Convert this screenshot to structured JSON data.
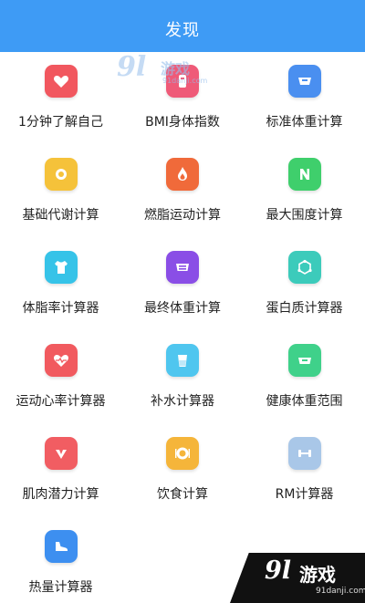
{
  "header": {
    "title": "发现"
  },
  "tools": [
    {
      "label": "1分钟了解自己",
      "icon": "heart-icon",
      "color": "#f1575f"
    },
    {
      "label": "BMI身体指数",
      "icon": "body-icon",
      "color": "#ef5a78"
    },
    {
      "label": "标准体重计算",
      "icon": "scale-icon",
      "color": "#4a8ff0"
    },
    {
      "label": "基础代谢计算",
      "icon": "metabolism-icon",
      "color": "#f5c23a"
    },
    {
      "label": "燃脂运动计算",
      "icon": "flame-icon",
      "color": "#f06a3a"
    },
    {
      "label": "最大围度计算",
      "icon": "n-icon",
      "color": "#3fcf6c"
    },
    {
      "label": "体脂率计算器",
      "icon": "shirt-icon",
      "color": "#36c3e8"
    },
    {
      "label": "最终体重计算",
      "icon": "target-weight-icon",
      "color": "#8a4ee6"
    },
    {
      "label": "蛋白质计算器",
      "icon": "molecule-icon",
      "color": "#3ccbbb"
    },
    {
      "label": "运动心率计算器",
      "icon": "heartbeat-icon",
      "color": "#f15a5f"
    },
    {
      "label": "补水计算器",
      "icon": "water-cup-icon",
      "color": "#4fc6ef"
    },
    {
      "label": "健康体重范围",
      "icon": "health-scale-icon",
      "color": "#3fd18a"
    },
    {
      "label": "肌肉潜力计算",
      "icon": "muscle-icon",
      "color": "#f15d62"
    },
    {
      "label": "饮食计算",
      "icon": "plate-icon",
      "color": "#f5b53a"
    },
    {
      "label": "RM计算器",
      "icon": "dumbbell-icon",
      "color": "#a9c7e8"
    },
    {
      "label": "热量计算器",
      "icon": "shoe-icon",
      "color": "#3d8ff0"
    }
  ],
  "watermark_top": {
    "num": "9l",
    "text": "游戏",
    "url": "91danji.com"
  },
  "watermark_bottom": {
    "num": "9l",
    "text": "游戏",
    "url": "91danji.com"
  }
}
